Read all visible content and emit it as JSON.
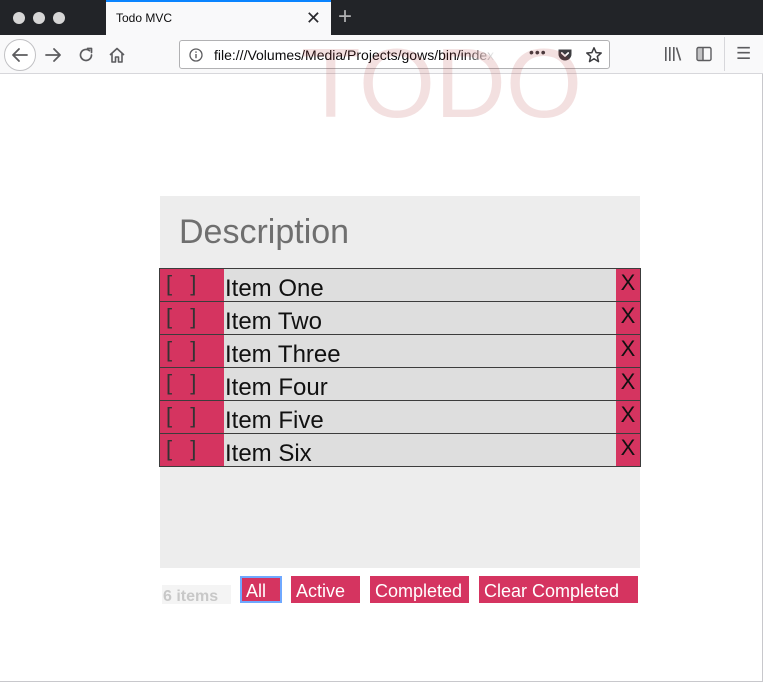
{
  "browser": {
    "tab_title": "Todo MVC",
    "tab_close_glyph": "✕",
    "new_tab_glyph": "+",
    "url": "file:///Volumes/Media/Projects/gows/bin/index.html",
    "page_actions_glyph": "•••",
    "menu_glyph": "☰",
    "icons": [
      "back-arrow-icon",
      "forward-arrow-icon",
      "reload-icon",
      "home-icon",
      "info-icon",
      "pocket-icon",
      "bookmark-star-icon",
      "library-icon",
      "sidebar-icon",
      "menu-icon"
    ]
  },
  "app": {
    "title": "TODO",
    "new_todo_placeholder": "Description",
    "todos": [
      {
        "toggle": "[ ]",
        "label": "Item One",
        "delete": "X"
      },
      {
        "toggle": "[ ]",
        "label": "Item Two",
        "delete": "X"
      },
      {
        "toggle": "[ ]",
        "label": "Item Three",
        "delete": "X"
      },
      {
        "toggle": "[ ]",
        "label": "Item Four",
        "delete": "X"
      },
      {
        "toggle": "[ ]",
        "label": "Item Five",
        "delete": "X"
      },
      {
        "toggle": "[ ]",
        "label": "Item Six",
        "delete": "X"
      }
    ],
    "footer": {
      "count": "6 items",
      "filters": [
        "All",
        "Active",
        "Completed"
      ],
      "selected_filter": "All",
      "clear_completed": "Clear Completed"
    }
  },
  "colors": {
    "accent": "#d53460",
    "title": "#f3dede",
    "panel_bg": "#ededed",
    "row_bg": "#dedede",
    "tab_accent": "#0a84ff",
    "selected_outline": "#6fa8ff"
  }
}
